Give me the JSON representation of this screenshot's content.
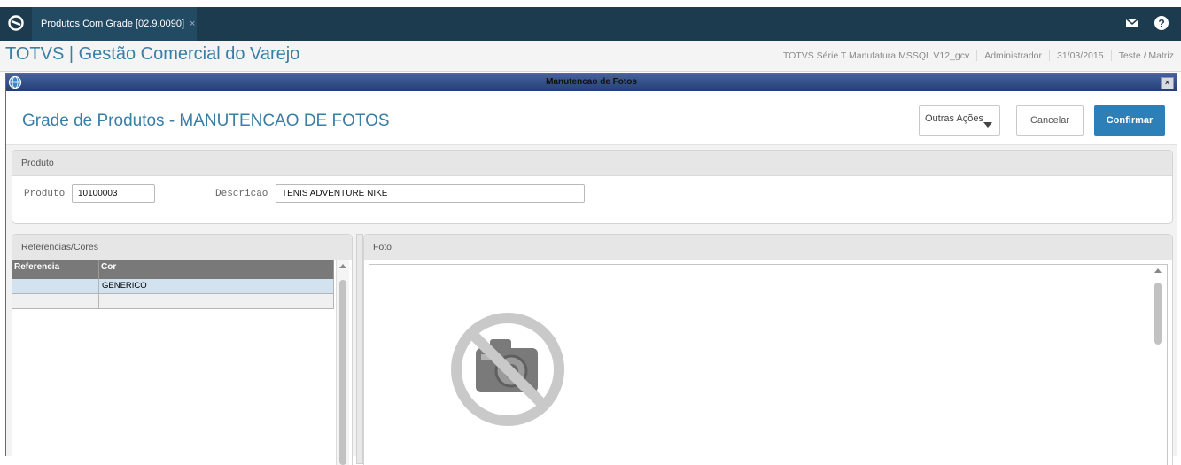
{
  "topbar": {
    "tab_label": "Produtos Com Grade [02.9.0090]",
    "tab_close": "×"
  },
  "header": {
    "app_title": "TOTVS | Gestão Comercial do Varejo",
    "system": "TOTVS Série T Manufatura MSSQL V12_gcv",
    "user": "Administrador",
    "date": "31/03/2015",
    "branch": "Teste / Matriz"
  },
  "dialog": {
    "title": "Manutencao de Fotos",
    "close": "×",
    "page_title": "Grade de Produtos - MANUTENCAO DE FOTOS",
    "buttons": {
      "outras": "Outras Ações",
      "cancelar": "Cancelar",
      "confirmar": "Confirmar"
    }
  },
  "produto": {
    "group_label": "Produto",
    "produto_label": "Produto",
    "produto_value": "10100003",
    "descricao_label": "Descricao",
    "descricao_value": "TENIS ADVENTURE NIKE"
  },
  "referencias": {
    "group_label": "Referencias/Cores",
    "columns": [
      "Referencia",
      "Cor"
    ],
    "rows": [
      {
        "referencia": "",
        "cor": "GENERICO"
      },
      {
        "referencia": "",
        "cor": ""
      }
    ]
  },
  "foto": {
    "group_label": "Foto"
  },
  "colors": {
    "topbar": "#1d3b4f",
    "accent": "#3a7ea6",
    "confirm": "#2d7fb8"
  },
  "icons": [
    "app-logo-icon",
    "mail-icon",
    "help-icon",
    "globe-icon",
    "no-photo-icon"
  ]
}
